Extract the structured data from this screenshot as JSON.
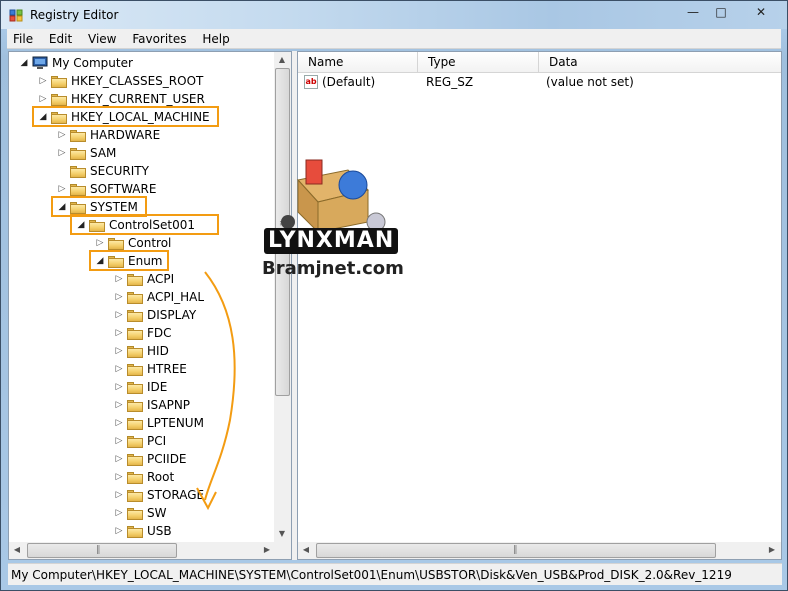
{
  "window": {
    "title": "Registry Editor",
    "controls": {
      "minimize": "—",
      "maximize": "□",
      "close": "✕"
    }
  },
  "menu": [
    "File",
    "Edit",
    "View",
    "Favorites",
    "Help"
  ],
  "tree": {
    "items": [
      {
        "label": "My Computer",
        "level": 0,
        "icon": "computer-icon",
        "expander": "open"
      },
      {
        "label": "HKEY_CLASSES_ROOT",
        "level": 1,
        "icon": "folder-icon",
        "expander": "closed"
      },
      {
        "label": "HKEY_CURRENT_USER",
        "level": 1,
        "icon": "folder-icon",
        "expander": "closed"
      },
      {
        "label": "HKEY_LOCAL_MACHINE",
        "level": 1,
        "icon": "folder-icon",
        "expander": "open",
        "highlight": true
      },
      {
        "label": "HARDWARE",
        "level": 2,
        "icon": "folder-icon",
        "expander": "closed"
      },
      {
        "label": "SAM",
        "level": 2,
        "icon": "folder-icon",
        "expander": "closed"
      },
      {
        "label": "SECURITY",
        "level": 2,
        "icon": "folder-icon",
        "expander": "none"
      },
      {
        "label": "SOFTWARE",
        "level": 2,
        "icon": "folder-icon",
        "expander": "closed"
      },
      {
        "label": "SYSTEM",
        "level": 2,
        "icon": "folder-icon",
        "expander": "open",
        "highlight": true
      },
      {
        "label": "ControlSet001",
        "level": 3,
        "icon": "folder-icon",
        "expander": "open",
        "highlight": true
      },
      {
        "label": "Control",
        "level": 4,
        "icon": "folder-icon",
        "expander": "closed"
      },
      {
        "label": "Enum",
        "level": 4,
        "icon": "folder-icon",
        "expander": "open",
        "highlight": true
      },
      {
        "label": "ACPI",
        "level": 5,
        "icon": "folder-icon",
        "expander": "closed"
      },
      {
        "label": "ACPI_HAL",
        "level": 5,
        "icon": "folder-icon",
        "expander": "closed"
      },
      {
        "label": "DISPLAY",
        "level": 5,
        "icon": "folder-icon",
        "expander": "closed"
      },
      {
        "label": "FDC",
        "level": 5,
        "icon": "folder-icon",
        "expander": "closed"
      },
      {
        "label": "HID",
        "level": 5,
        "icon": "folder-icon",
        "expander": "closed"
      },
      {
        "label": "HTREE",
        "level": 5,
        "icon": "folder-icon",
        "expander": "closed"
      },
      {
        "label": "IDE",
        "level": 5,
        "icon": "folder-icon",
        "expander": "closed"
      },
      {
        "label": "ISAPNP",
        "level": 5,
        "icon": "folder-icon",
        "expander": "closed"
      },
      {
        "label": "LPTENUM",
        "level": 5,
        "icon": "folder-icon",
        "expander": "closed"
      },
      {
        "label": "PCI",
        "level": 5,
        "icon": "folder-icon",
        "expander": "closed"
      },
      {
        "label": "PCIIDE",
        "level": 5,
        "icon": "folder-icon",
        "expander": "closed"
      },
      {
        "label": "Root",
        "level": 5,
        "icon": "folder-icon",
        "expander": "closed"
      },
      {
        "label": "STORAGE",
        "level": 5,
        "icon": "folder-icon",
        "expander": "closed"
      },
      {
        "label": "SW",
        "level": 5,
        "icon": "folder-icon",
        "expander": "closed"
      },
      {
        "label": "USB",
        "level": 5,
        "icon": "folder-icon",
        "expander": "closed"
      }
    ]
  },
  "list": {
    "columns": [
      "Name",
      "Type",
      "Data"
    ],
    "rows": [
      {
        "name": "(Default)",
        "type": "REG_SZ",
        "data": "(value not set)",
        "icon": "string-value-icon"
      }
    ]
  },
  "status": "My Computer\\HKEY_LOCAL_MACHINE\\SYSTEM\\ControlSet001\\Enum\\USBSTOR\\Disk&Ven_USB&Prod_DISK_2.0&Rev_1219",
  "watermark": {
    "line1": "LYNXMAN",
    "line2": "Bramjnet.com"
  },
  "colors": {
    "highlight": "#f39c12",
    "folder": "#f3cf6a"
  }
}
